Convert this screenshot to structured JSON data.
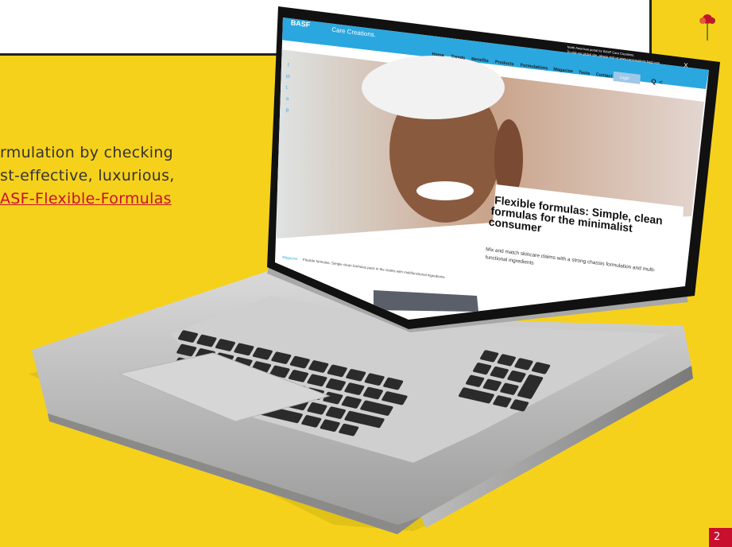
{
  "paragraph": {
    "line1": "rmulation by checking",
    "line2": "st-effective,  luxurious,",
    "link": "ASF-Flexible-Formulas"
  },
  "page_number": "2",
  "site": {
    "brand": "BASF",
    "brand_tagline": "We create chemistry",
    "sub_brand": "Care Creations.",
    "notice_line1": "North American portal for BASF Care Creations.",
    "notice_line2": "To visit our global site, please visit us www.carecreations.basf.com",
    "close_label": "X",
    "nav": [
      "Home",
      "Trends",
      "Benefits",
      "Products",
      "Formulations",
      "Magazine",
      "Tools",
      "Contact"
    ],
    "login_label": "Login",
    "hero_title": "Flexible formulas: Simple, clean formulas for the minimalist consumer",
    "hero_title_l1": "Flexible formulas: Simple, clean",
    "hero_title_l2": "formulas for the minimalist",
    "hero_title_l3": "consumer",
    "hero_desc_l1": "Mix and match skincare claims with a strong chassis formulation and multi-",
    "hero_desc_l2": "functional ingredients",
    "breadcrumb_root": "Magazine",
    "breadcrumb_current": "Flexible formulas: Simple clean formulas pack in the claims with multifunctional ingredients",
    "social": [
      "f",
      "in",
      "t",
      "o",
      "p"
    ]
  },
  "colors": {
    "background": "#f6d11c",
    "link": "#c8102e",
    "site_header": "#2aa7de"
  }
}
